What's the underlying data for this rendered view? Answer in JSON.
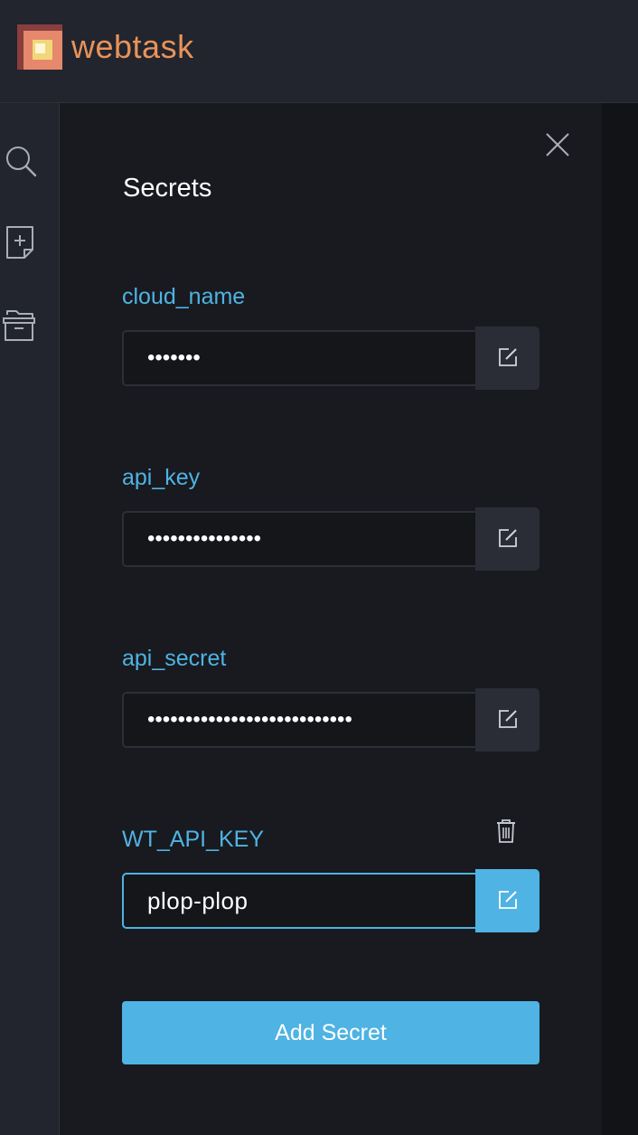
{
  "app": {
    "brand": "webtask",
    "accent_color": "#e8935a"
  },
  "sidebar": {
    "items": [
      {
        "icon": "search-icon"
      },
      {
        "icon": "new-file-icon"
      },
      {
        "icon": "open-folder-icon"
      }
    ]
  },
  "panel": {
    "title": "Secrets",
    "close_icon": "close-icon",
    "secrets": [
      {
        "name": "cloud_name",
        "value": "•••••••"
      },
      {
        "name": "api_key",
        "value": "•••••••••••••••"
      },
      {
        "name": "api_secret",
        "value": "•••••••••••••••••••••••••••"
      },
      {
        "name": "WT_API_KEY",
        "value": "plop-plop",
        "delete_icon": "trash-icon"
      }
    ],
    "add_button_label": "Add Secret",
    "highlight_color": "#4fb3e3"
  }
}
